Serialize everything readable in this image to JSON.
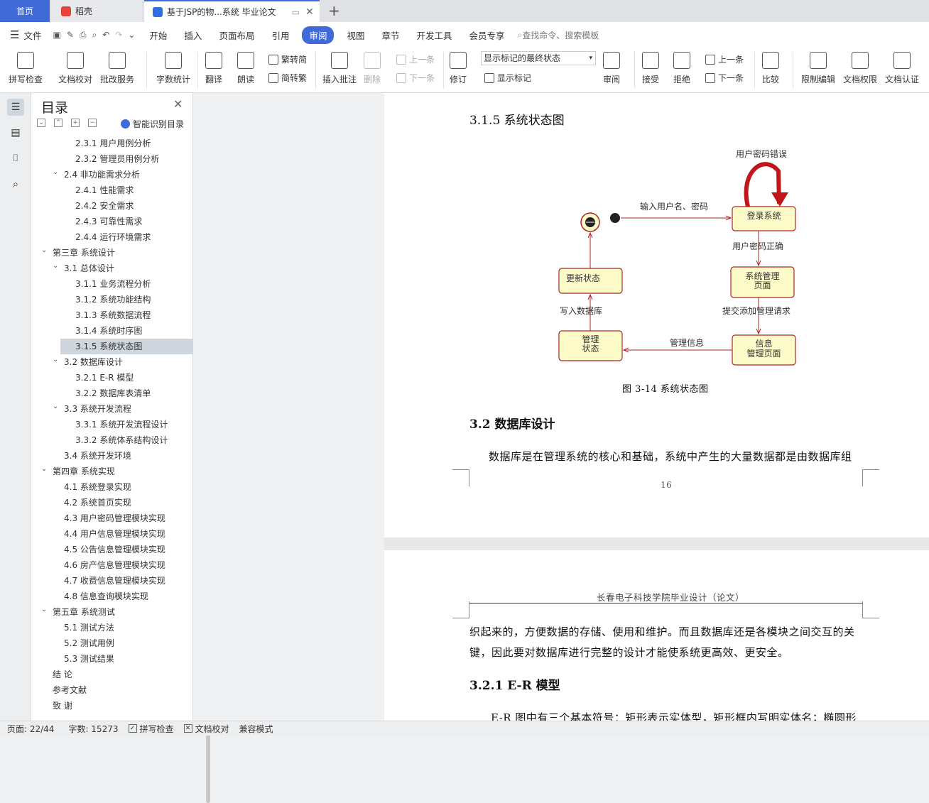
{
  "tabs": {
    "home": "首页",
    "daoke": "稻壳",
    "doc": "基于JSP的物...系统 毕业论文"
  },
  "menu": {
    "file": "文件",
    "items": [
      "开始",
      "插入",
      "页面布局",
      "引用",
      "审阅",
      "视图",
      "章节",
      "开发工具",
      "会员专享"
    ],
    "active": "审阅",
    "search": "查找命令、搜索模板"
  },
  "toolbar": {
    "spell": "拼写检查",
    "proof": "文档校对",
    "batch": "批改服务",
    "wordcount": "字数统计",
    "translate": "翻译",
    "read": "朗读",
    "trad": "繁转简",
    "simp": "简转繁",
    "insert_comment": "插入批注",
    "delete": "删除",
    "prev_comment": "上一条",
    "next_comment": "下一条",
    "track": "修订",
    "markup_select": "显示标记的最终状态",
    "show_markup": "显示标记",
    "review": "审阅",
    "accept": "接受",
    "reject": "拒绝",
    "prev": "上一条",
    "next": "下一条",
    "compare": "比较",
    "restrict": "限制编辑",
    "perm": "文档权限",
    "cert": "文档认证"
  },
  "toc": {
    "title": "目录",
    "smart": "智能识别目录",
    "items": [
      {
        "t": "2.3.1  用户用例分析",
        "lv": 3
      },
      {
        "t": "2.3.2  管理员用例分析",
        "lv": 3
      },
      {
        "t": "2.4  非功能需求分析",
        "lv": 2,
        "open": true
      },
      {
        "t": "2.4.1  性能需求",
        "lv": 3
      },
      {
        "t": "2.4.2  安全需求",
        "lv": 3
      },
      {
        "t": "2.4.3  可靠性需求",
        "lv": 3
      },
      {
        "t": "2.4.4  运行环境需求",
        "lv": 3
      },
      {
        "t": "第三章  系统设计",
        "lv": 1,
        "open": true
      },
      {
        "t": "3.1  总体设计",
        "lv": 2,
        "open": true
      },
      {
        "t": "3.1.1  业务流程分析",
        "lv": 3
      },
      {
        "t": "3.1.2  系统功能结构",
        "lv": 3
      },
      {
        "t": "3.1.3  系统数据流程",
        "lv": 3
      },
      {
        "t": "3.1.4  系统时序图",
        "lv": 3
      },
      {
        "t": "3.1.5  系统状态图",
        "lv": 3,
        "sel": true
      },
      {
        "t": "3.2  数据库设计",
        "lv": 2,
        "open": true
      },
      {
        "t": "3.2.1 E-R 模型",
        "lv": 3
      },
      {
        "t": "3.2.2  数据库表清单",
        "lv": 3
      },
      {
        "t": "3.3  系统开发流程",
        "lv": 2,
        "open": true
      },
      {
        "t": "3.3.1  系统开发流程设计",
        "lv": 3
      },
      {
        "t": "3.3.2  系统体系结构设计",
        "lv": 3
      },
      {
        "t": "3.4  系统开发环境",
        "lv": 2
      },
      {
        "t": "第四章  系统实现",
        "lv": 1,
        "open": true
      },
      {
        "t": "4.1  系统登录实现",
        "lv": 2
      },
      {
        "t": "4.2  系统首页实现",
        "lv": 2
      },
      {
        "t": "4.3  用户密码管理模块实现",
        "lv": 2
      },
      {
        "t": "4.4  用户信息管理模块实现",
        "lv": 2
      },
      {
        "t": "4.5  公告信息管理模块实现",
        "lv": 2
      },
      {
        "t": "4.6  房产信息管理模块实现",
        "lv": 2
      },
      {
        "t": "4.7  收费信息管理模块实现",
        "lv": 2
      },
      {
        "t": "4.8  信息查询模块实现",
        "lv": 2
      },
      {
        "t": "第五章  系统测试",
        "lv": 1,
        "open": true
      },
      {
        "t": "5.1  测试方法",
        "lv": 2
      },
      {
        "t": "5.2  测试用例",
        "lv": 2
      },
      {
        "t": "5.3  测试结果",
        "lv": 2
      },
      {
        "t": "结      论",
        "lv": 1
      },
      {
        "t": "参考文献",
        "lv": 1
      },
      {
        "t": "致      谢",
        "lv": 1
      }
    ]
  },
  "doc": {
    "h315": "3.1.5  系统状态图",
    "diagram": {
      "login": "登录系统",
      "mgmt_page": "系统管理\n页面",
      "info_page": "信息\n管理页面",
      "manage_state": "管理\n状态",
      "update_state": "更新状态",
      "lbl_input": "输入用户名、密码",
      "lbl_err": "用户密码错误",
      "lbl_ok": "用户密码正确",
      "lbl_submit": "提交添加管理请求",
      "lbl_info": "管理信息",
      "lbl_write": "写入数据库"
    },
    "caption": "图 3-14  系统状态图",
    "h32": "3.2  数据库设计",
    "p1": "数据库是在管理系统的核心和基础，系统中产生的大量数据都是由数据库组",
    "pagenum": "16",
    "header2": "长春电子科技学院毕业设计（论文）",
    "p2a": "织起来的，方便数据的存储、使用和维护。而且数据库还是各模块之间交互的关",
    "p2b": "键，因此要对数据库进行完整的设计才能使系统更高效、更安全。",
    "h321": "3.2.1 E-R 模型",
    "p3": "E-R 图中有三个基本符号：矩形表示实体型，矩形框内写明实体名；椭圆形"
  },
  "status": {
    "page": "页面: 22/44",
    "words": "字数: 15273",
    "spell": "拼写检查",
    "proof": "文档校对",
    "compat": "兼容模式"
  }
}
